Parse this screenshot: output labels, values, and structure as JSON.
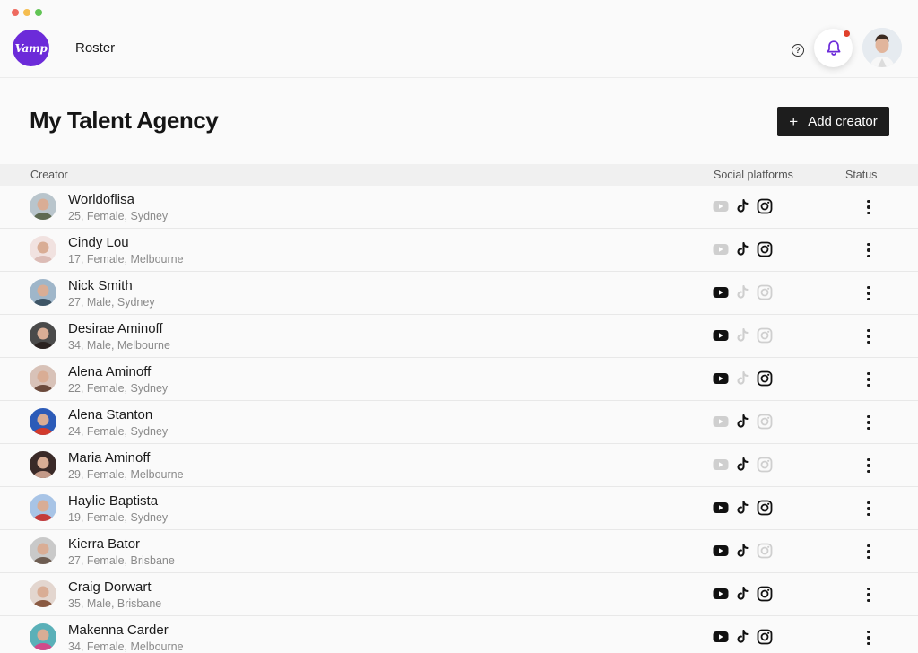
{
  "app": {
    "logo_text": "Vamp",
    "nav_title": "Roster",
    "help_glyph": "?",
    "brand_color": "#6c2bd9"
  },
  "header": {
    "title": "My Talent Agency",
    "add_button_label": "Add creator",
    "add_icon": "+"
  },
  "table": {
    "columns": {
      "creator": "Creator",
      "social": "Social platforms",
      "status": "Status"
    },
    "rows": [
      {
        "name": "Worldoflisa",
        "meta": "25, Female, Sydney",
        "youtube": false,
        "tiktok": true,
        "instagram": true,
        "avatar_bg": "#b9c5cc",
        "avatar_fg": "#5e6a52"
      },
      {
        "name": "Cindy Lou",
        "meta": "17, Female, Melbourne",
        "youtube": false,
        "tiktok": true,
        "instagram": true,
        "avatar_bg": "#f1e2e0",
        "avatar_fg": "#dcbcb6"
      },
      {
        "name": "Nick Smith",
        "meta": "27, Male, Sydney",
        "youtube": true,
        "tiktok": false,
        "instagram": false,
        "avatar_bg": "#9fb6c9",
        "avatar_fg": "#3e5566"
      },
      {
        "name": "Desirae Aminoff",
        "meta": "34, Male, Melbourne",
        "youtube": true,
        "tiktok": false,
        "instagram": false,
        "avatar_bg": "#4a4a4a",
        "avatar_fg": "#2a2220"
      },
      {
        "name": "Alena Aminoff",
        "meta": "22, Female, Sydney",
        "youtube": true,
        "tiktok": false,
        "instagram": true,
        "avatar_bg": "#d8c2b8",
        "avatar_fg": "#6b4a3c"
      },
      {
        "name": "Alena Stanton",
        "meta": "24, Female, Sydney",
        "youtube": false,
        "tiktok": true,
        "instagram": false,
        "avatar_bg": "#2c5bb8",
        "avatar_fg": "#d23a2c"
      },
      {
        "name": "Maria Aminoff",
        "meta": "29, Female, Melbourne",
        "youtube": false,
        "tiktok": true,
        "instagram": false,
        "avatar_bg": "#3a2a28",
        "avatar_fg": "#c49a88"
      },
      {
        "name": "Haylie Baptista",
        "meta": "19, Female, Sydney",
        "youtube": true,
        "tiktok": true,
        "instagram": true,
        "avatar_bg": "#a8c4e6",
        "avatar_fg": "#c43a3a"
      },
      {
        "name": "Kierra Bator",
        "meta": "27, Female, Brisbane",
        "youtube": true,
        "tiktok": true,
        "instagram": false,
        "avatar_bg": "#c9c9c9",
        "avatar_fg": "#6e5d52"
      },
      {
        "name": "Craig Dorwart",
        "meta": "35, Male, Brisbane",
        "youtube": true,
        "tiktok": true,
        "instagram": true,
        "avatar_bg": "#e3d6cf",
        "avatar_fg": "#8a5a42"
      },
      {
        "name": "Makenna Carder",
        "meta": "34, Female, Melbourne",
        "youtube": true,
        "tiktok": true,
        "instagram": true,
        "avatar_bg": "#5ab0b8",
        "avatar_fg": "#d24a8a"
      }
    ]
  }
}
